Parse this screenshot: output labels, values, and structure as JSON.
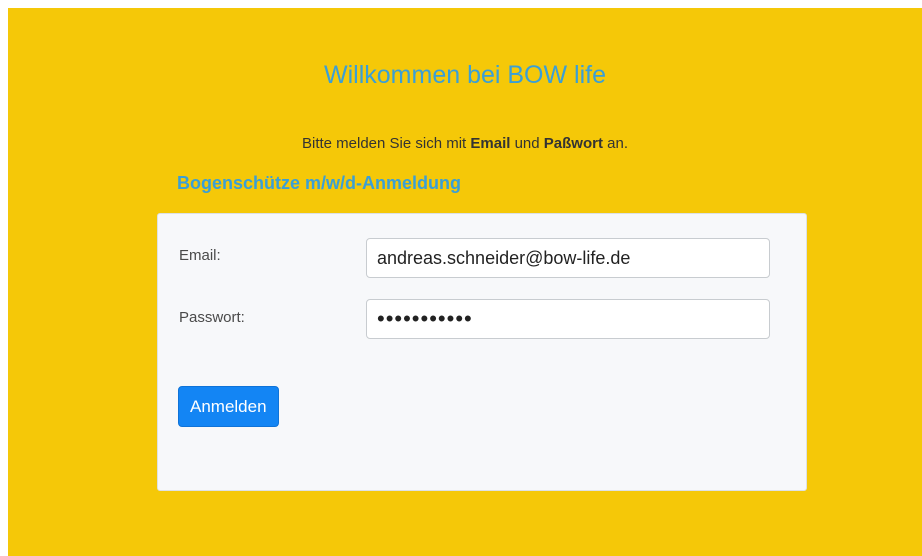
{
  "header": {
    "title": "Willkommen bei BOW life",
    "subtitle_prefix": "Bitte melden Sie sich mit ",
    "subtitle_email": "Email",
    "subtitle_and": " und ",
    "subtitle_password": "Paßwort",
    "subtitle_suffix": " an."
  },
  "login": {
    "heading": "Bogenschütze m/w/d-Anmeldung",
    "email_label": "Email:",
    "email_value": "andreas.schneider@bow-life.de",
    "password_label": "Passwort:",
    "password_value": "•••••••••••",
    "submit_label": "Anmelden"
  },
  "colors": {
    "background": "#f5c808",
    "accent": "#3a9fd6",
    "button": "#1385f4"
  }
}
